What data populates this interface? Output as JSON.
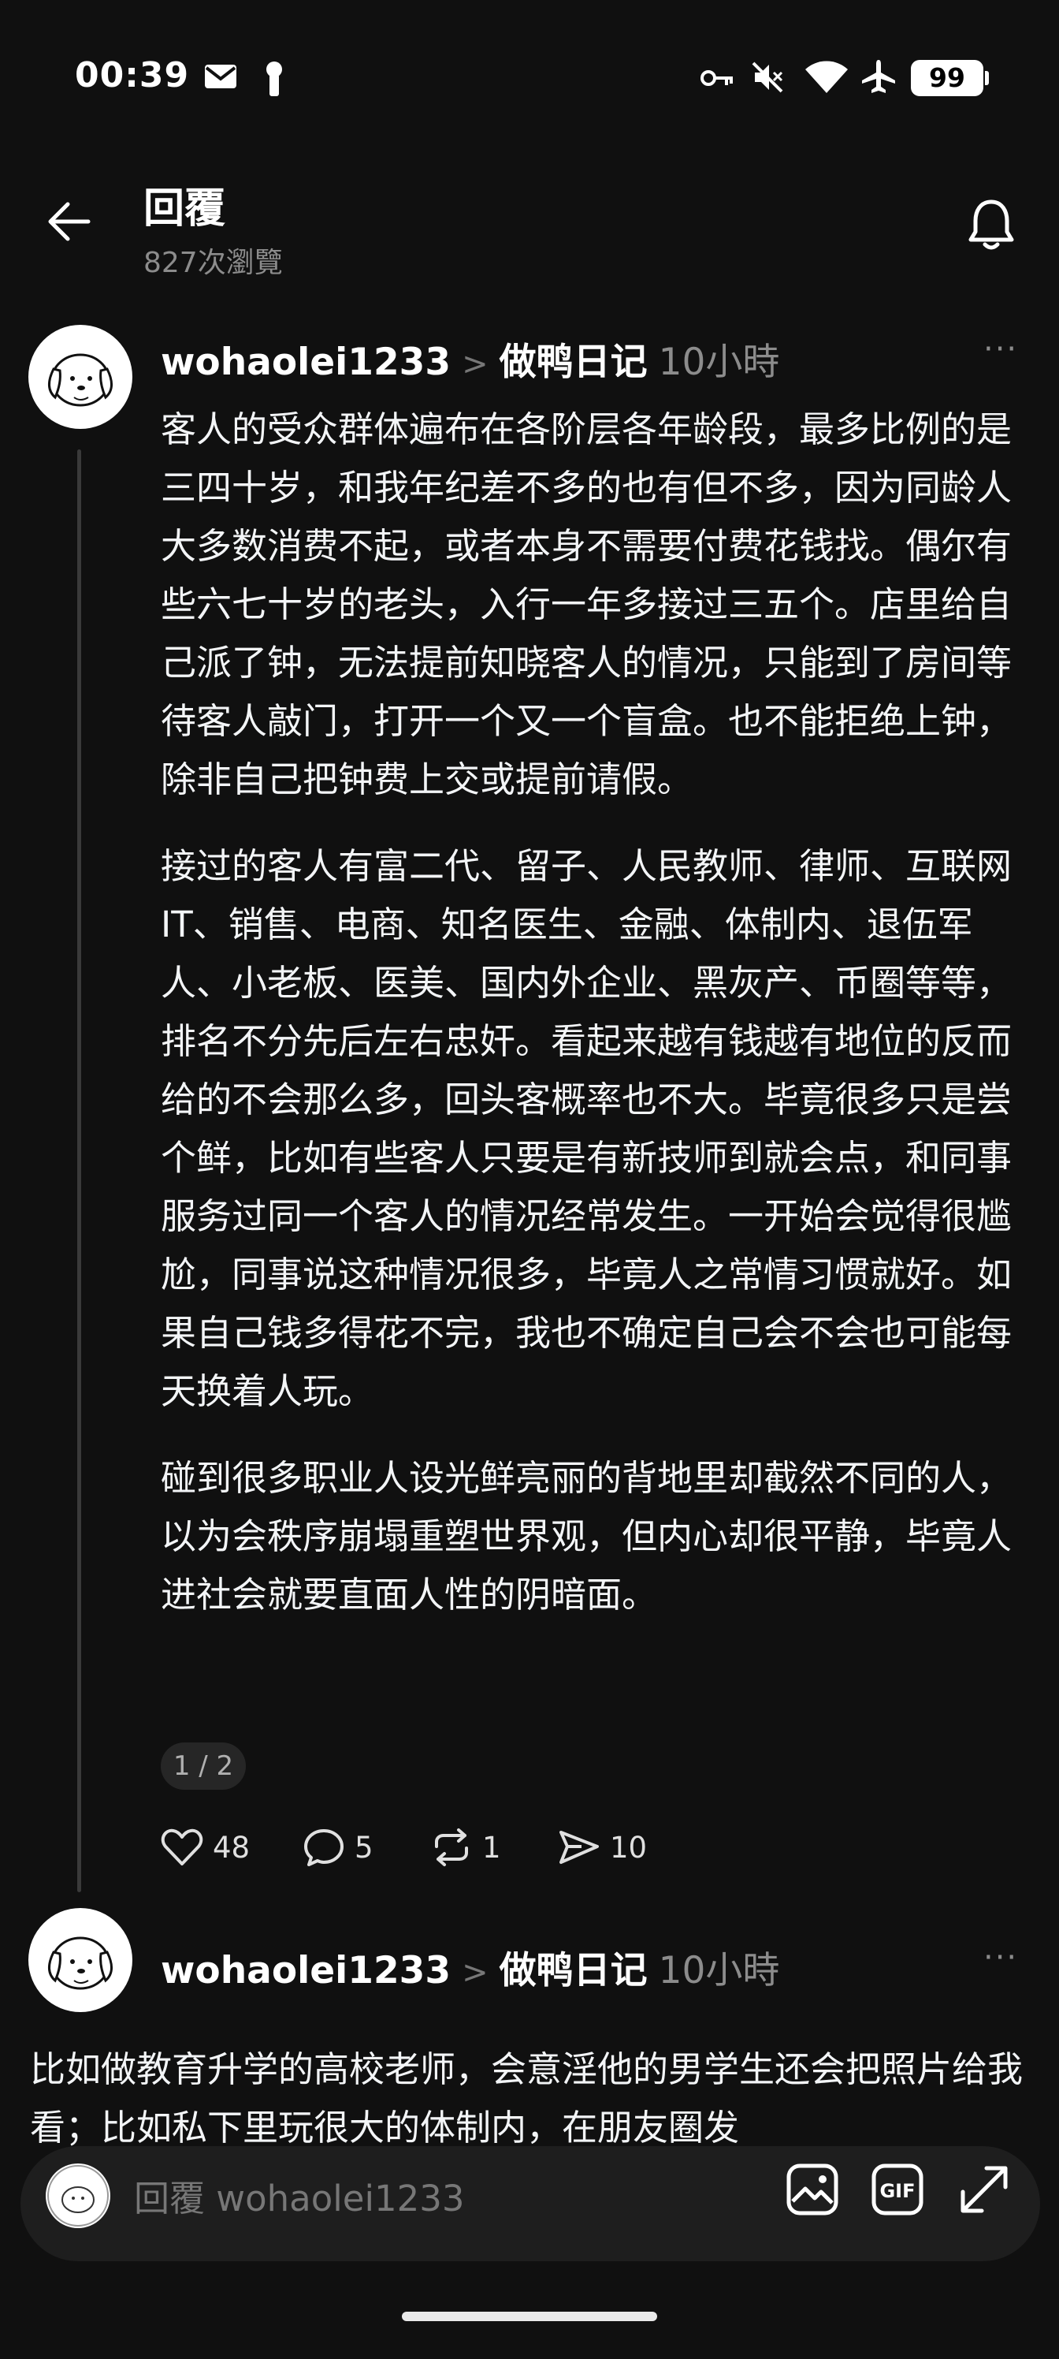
{
  "status_bar": {
    "time": "00:39",
    "battery": "99",
    "icons": [
      "mail-icon",
      "lock-icon",
      "key-icon",
      "mute-icon",
      "wifi-icon",
      "airplane-icon"
    ]
  },
  "header": {
    "title": "回覆",
    "views": "827次瀏覽"
  },
  "post1": {
    "username": "wohaolei1233",
    "separator": ">",
    "topic": "做鸭日记",
    "time": "10小時",
    "more": "···",
    "paragraphs": [
      "客人的受众群体遍布在各阶层各年龄段，最多比例的是三四十岁，和我年纪差不多的也有但不多，因为同龄人大多数消费不起，或者本身不需要付费花钱找。偶尔有些六七十岁的老头，入行一年多接过三五个。店里给自己派了钟，无法提前知晓客人的情况，只能到了房间等待客人敲门，打开一个又一个盲盒。也不能拒绝上钟，除非自己把钟费上交或提前请假。",
      "接过的客人有富二代、留子、人民教师、律师、互联网IT、销售、电商、知名医生、金融、体制内、退伍军人、小老板、医美、国内外企业、黑灰产、币圈等等，排名不分先后左右忠奸。看起来越有钱越有地位的反而给的不会那么多，回头客概率也不大。毕竟很多只是尝个鲜，比如有些客人只要是有新技师到就会点，和同事服务过同一个客人的情况经常发生。一开始会觉得很尴尬，同事说这种情况很多，毕竟人之常情习惯就好。如果自己钱多得花不完，我也不确定自己会不会也可能每天换着人玩。",
      "碰到很多职业人设光鲜亮丽的背地里却截然不同的人，以为会秩序崩塌重塑世界观，但内心却很平静，毕竟人进社会就要直面人性的阴暗面。"
    ],
    "page": "1 / 2",
    "actions": {
      "likes": "48",
      "replies": "5",
      "reposts": "1",
      "shares": "10"
    }
  },
  "post2": {
    "username": "wohaolei1233",
    "separator": ">",
    "topic": "做鸭日记",
    "time": "10小時",
    "more": "···",
    "text": "比如做教育升学的高校老师，会意淫他的男学生还会把照片给我看；比如私下里玩很大的体制内，在朋友圈发"
  },
  "reply_bar": {
    "placeholder": "回覆 wohaolei1233",
    "gif_label": "GIF"
  }
}
